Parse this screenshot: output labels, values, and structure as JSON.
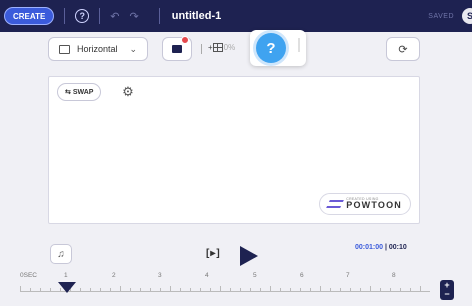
{
  "topbar": {
    "create_label": "CREATE",
    "help_glyph": "?",
    "undo_icon": "undo-icon",
    "redo_icon": "redo-icon",
    "title": "untitled-1",
    "saved_label": "SAVED"
  },
  "toolbar": {
    "orientation_value": "Horizontal",
    "zoom_prefix": "+",
    "zoom_value": "0%",
    "help_glyph": "?"
  },
  "canvas": {
    "swap_label": "SWAP",
    "brand_small": "CREATED USING",
    "brand_name": "POWTOON"
  },
  "player": {
    "frame_label": "[▸]",
    "current_time": "00:01:00",
    "separator": " | ",
    "total_time": "00:10"
  },
  "timeline": {
    "start_label": "0SEC",
    "ticks": [
      "1",
      "2",
      "3",
      "4",
      "5",
      "6",
      "7",
      "8"
    ],
    "zoom_plus": "+",
    "zoom_minus": "−"
  },
  "colors": {
    "topbar_bg": "#1e2251",
    "accent": "#3b5bdb",
    "help": "#3fa3f0",
    "notification": "#e5484d"
  }
}
